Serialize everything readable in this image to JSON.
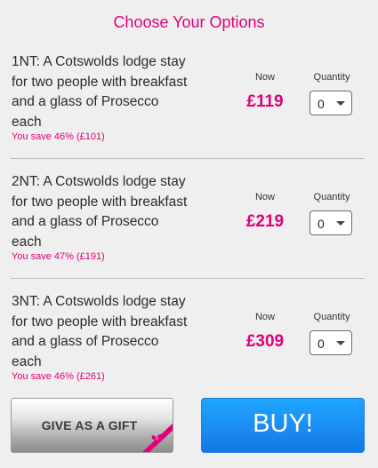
{
  "header": {
    "title": "Choose Your Options"
  },
  "options": [
    {
      "description": "1NT: A Cotswolds lodge stay for two people with breakfast and a glass of Prosecco each",
      "savings": "You save 46% (£101)",
      "price_label": "Now",
      "price": "£119",
      "quantity_label": "Quantity",
      "quantity": "0"
    },
    {
      "description": "2NT: A Cotswolds lodge stay for two people with breakfast and a glass of Prosecco each",
      "savings": "You save 47% (£191)",
      "price_label": "Now",
      "price": "£219",
      "quantity_label": "Quantity",
      "quantity": "0"
    },
    {
      "description": "3NT: A Cotswolds lodge stay for two people with breakfast and a glass of Prosecco each",
      "savings": "You save 46% (£261)",
      "price_label": "Now",
      "price": "£309",
      "quantity_label": "Quantity",
      "quantity": "0"
    }
  ],
  "actions": {
    "gift_label": "GIVE AS A GIFT",
    "buy_label": "BUY!"
  },
  "colors": {
    "accent": "#e0007a",
    "buy_button": "#1b8cf2",
    "background": "#efefef"
  },
  "icons": {
    "gift": "gift-ribbon-icon",
    "select_arrow": "chevron-down-icon"
  }
}
